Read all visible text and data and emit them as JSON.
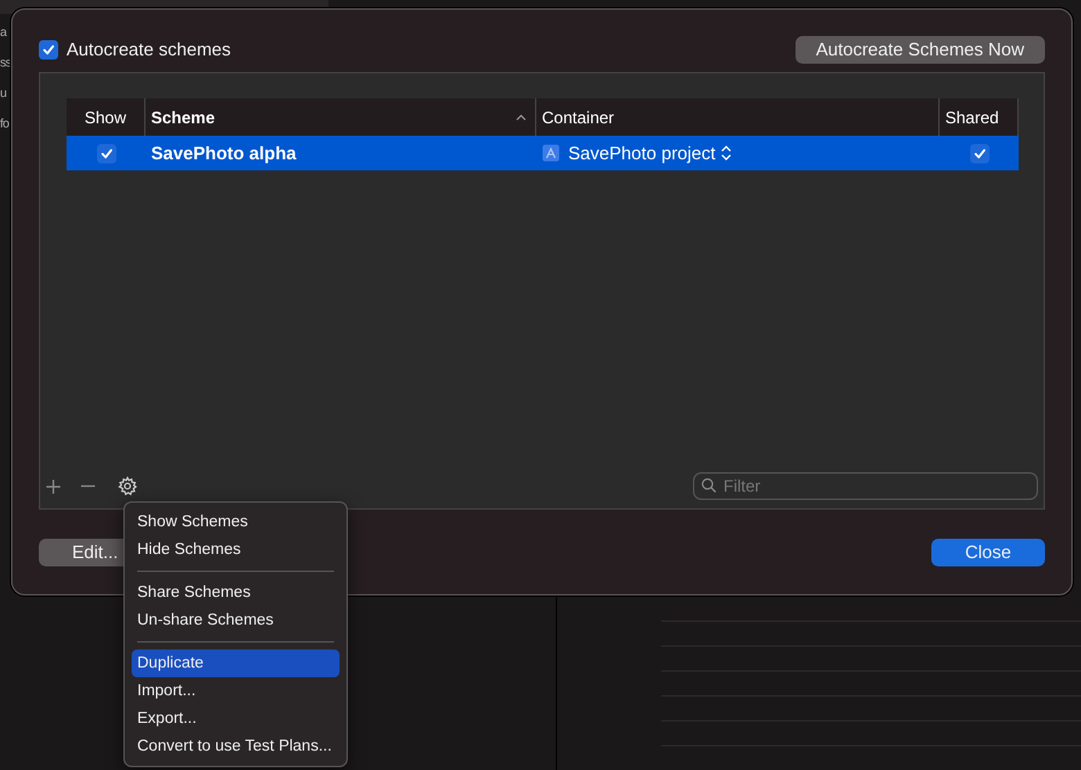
{
  "background": {
    "sidebar_fragments": [
      "a",
      "ss",
      "u",
      "fo"
    ]
  },
  "dialog": {
    "autocreate": {
      "label": "Autocreate schemes",
      "checked": true
    },
    "autocreate_now_button": "Autocreate Schemes Now",
    "table": {
      "columns": [
        {
          "label": "Show",
          "sorted": false
        },
        {
          "label": "Scheme",
          "sorted": true
        },
        {
          "label": "Container",
          "sorted": false
        },
        {
          "label": "Shared",
          "sorted": false
        }
      ],
      "rows": [
        {
          "show": true,
          "scheme": "SavePhoto alpha",
          "container": "SavePhoto project",
          "shared": true,
          "selected": true
        }
      ]
    },
    "toolbar": {
      "filter_placeholder": "Filter"
    },
    "edit_button": "Edit...",
    "close_button": "Close"
  },
  "menu": {
    "items": [
      {
        "kind": "item",
        "label": "Show Schemes",
        "selected": false
      },
      {
        "kind": "item",
        "label": "Hide Schemes",
        "selected": false
      },
      {
        "kind": "separator"
      },
      {
        "kind": "item",
        "label": "Share Schemes",
        "selected": false
      },
      {
        "kind": "item",
        "label": "Un-share Schemes",
        "selected": false
      },
      {
        "kind": "separator"
      },
      {
        "kind": "item",
        "label": "Duplicate",
        "selected": true
      },
      {
        "kind": "item",
        "label": "Import...",
        "selected": false
      },
      {
        "kind": "item",
        "label": "Export...",
        "selected": false
      },
      {
        "kind": "item",
        "label": "Convert to use Test Plans...",
        "selected": false
      }
    ]
  }
}
